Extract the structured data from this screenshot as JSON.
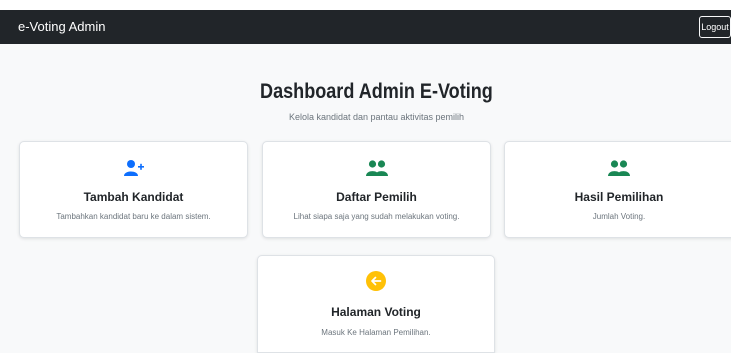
{
  "navbar": {
    "brand": "e-Voting Admin",
    "logout_label": "Logout"
  },
  "header": {
    "title": "Dashboard Admin E-Voting",
    "subtitle": "Kelola kandidat dan pantau aktivitas pemilih"
  },
  "cards": [
    {
      "icon": "user-plus-icon",
      "title": "Tambah Kandidat",
      "text": "Tambahkan kandidat baru ke dalam sistem.",
      "icon_color": "#0d6efd"
    },
    {
      "icon": "users-icon",
      "title": "Daftar Pemilih",
      "text": "Lihat siapa saja yang sudah melakukan voting.",
      "icon_color": "#198754"
    },
    {
      "icon": "users-icon",
      "title": "Hasil Pemilihan",
      "text": "Jumlah Voting.",
      "icon_color": "#198754"
    },
    {
      "icon": "arrow-left-circle-icon",
      "title": "Halaman Voting",
      "text": "Masuk Ke Halaman Pemilihan.",
      "icon_color": "#ffc107"
    }
  ],
  "colors": {
    "navbar_bg": "#212529",
    "page_bg": "#f8f9fa"
  }
}
